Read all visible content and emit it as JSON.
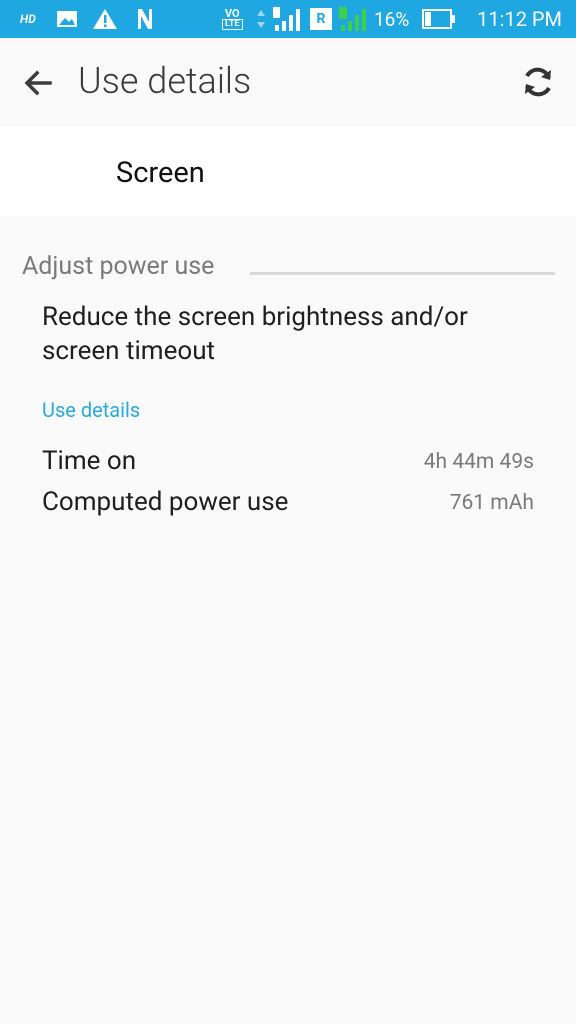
{
  "status_bar": {
    "hd": "HD",
    "volte_top": "VO",
    "volte_bottom": "LTE",
    "roaming": "R",
    "battery_percent": "16%",
    "time": "11:12 PM",
    "bg_color": "#1ea7e1"
  },
  "app_bar": {
    "title": "Use details",
    "back_icon": "arrow-back-icon",
    "refresh_icon": "refresh-icon"
  },
  "header": {
    "app_name": "Screen"
  },
  "section": {
    "title": "Adjust power use",
    "description": "Reduce the screen brightness and/or screen timeout"
  },
  "use_details": {
    "label": "Use details",
    "accent_color": "#29a9dc",
    "rows": [
      {
        "label": "Time on",
        "value": "4h 44m 49s"
      },
      {
        "label": "Computed power use",
        "value": "761 mAh"
      }
    ]
  }
}
